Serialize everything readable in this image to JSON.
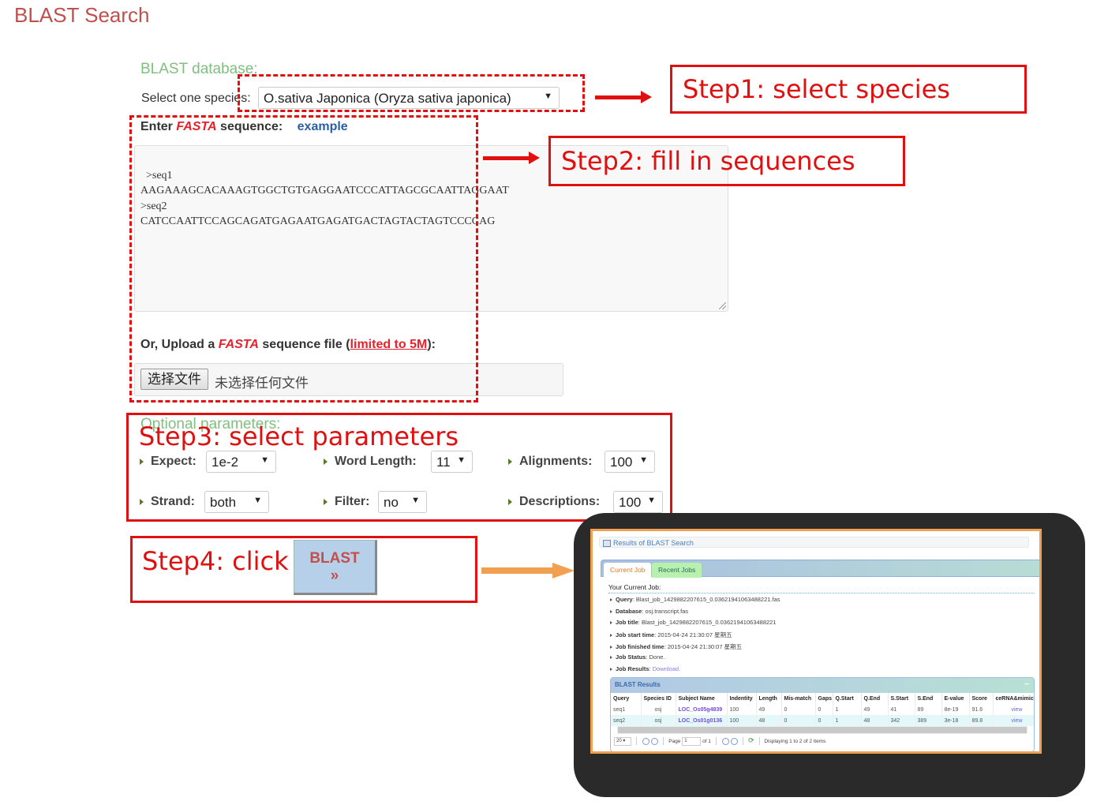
{
  "page_title": "BLAST Search",
  "blast_database": {
    "label": "BLAST database:",
    "species_label": "Select one species:",
    "species_selected": "O.sativa Japonica (Oryza sativa japonica)"
  },
  "fasta": {
    "enter_prefix": "Enter ",
    "fasta_word": "FASTA",
    "enter_suffix": " sequence:",
    "example_link": "example",
    "sequence_value": ">seq1\nAAGAAAGCACAAAGTGGCTGTGAGGAATCCCATTAGCGCAATTAGGAAT\n>seq2\nCATCCAATTCCAGCAGATGAGAATGAGATGACTAGTACTAGTCCCCAG",
    "upload_prefix": "Or, Upload a ",
    "upload_middle": " sequence file (",
    "upload_limit_link": "limited to 5M",
    "upload_suffix": "):",
    "choose_file_button": "选择文件",
    "no_file_text": "未选择任何文件"
  },
  "optional": {
    "label": "Optional parameters:",
    "params": [
      {
        "label": "Expect:",
        "value": "1e-2"
      },
      {
        "label": "Word Length:",
        "value": "11"
      },
      {
        "label": "Alignments:",
        "value": "100"
      },
      {
        "label": "Strand:",
        "value": "both"
      },
      {
        "label": "Filter:",
        "value": "no"
      },
      {
        "label": "Descriptions:",
        "value": "100"
      }
    ]
  },
  "blast_button": {
    "label": "BLAST",
    "chevron": "»"
  },
  "steps": {
    "step1": "Step1: select species",
    "step2": "Step2: fill in sequences",
    "step3": "Step3: select parameters",
    "step4": "Step4: click"
  },
  "results": {
    "header": "Results of BLAST Search",
    "tabs": [
      "Current Job",
      "Recent Jobs"
    ],
    "your_job_label": "Your Current Job:",
    "job_info": [
      {
        "key": "Query",
        "value": "Blast_job_1429882207615_0.03621941063488221.fas"
      },
      {
        "key": "Database",
        "value": "osj.transcript.fas"
      },
      {
        "key": "Job title",
        "value": "Blast_job_1429882207615_0.03621941063488221"
      },
      {
        "key": "Job start time",
        "value": "2015-04-24 21:30:07 星期五"
      },
      {
        "key": "Job finished time",
        "value": "2015-04-24 21:30:07 星期五"
      },
      {
        "key": "Job Status",
        "value": "Done."
      },
      {
        "key": "Job Results",
        "value": "Download."
      }
    ],
    "blast_results_title": "BLAST Results",
    "collapse_icon": "−",
    "columns": [
      "Query",
      "Species ID",
      "Subject Name",
      "Indentity",
      "Length",
      "Mis-match",
      "Gaps",
      "Q.Start",
      "Q.End",
      "S.Start",
      "S.End",
      "E-value",
      "Score",
      "ceRNA&mimic"
    ],
    "rows": [
      [
        "seq1",
        "osj",
        "LOC_Os05g4839",
        "100",
        "49",
        "0",
        "0",
        "1",
        "49",
        "41",
        "89",
        "8e-19",
        "91.6",
        "view"
      ],
      [
        "seq2",
        "osj",
        "LOC_Os01g0136",
        "100",
        "48",
        "0",
        "0",
        "1",
        "48",
        "342",
        "389",
        "3e-18",
        "89.8",
        "view"
      ]
    ],
    "pager": {
      "page_size": "20",
      "page_label": "Page",
      "page_value": "1",
      "of_label": "of 1",
      "display_text": "Displaying 1 to 2 of 2 items"
    }
  }
}
